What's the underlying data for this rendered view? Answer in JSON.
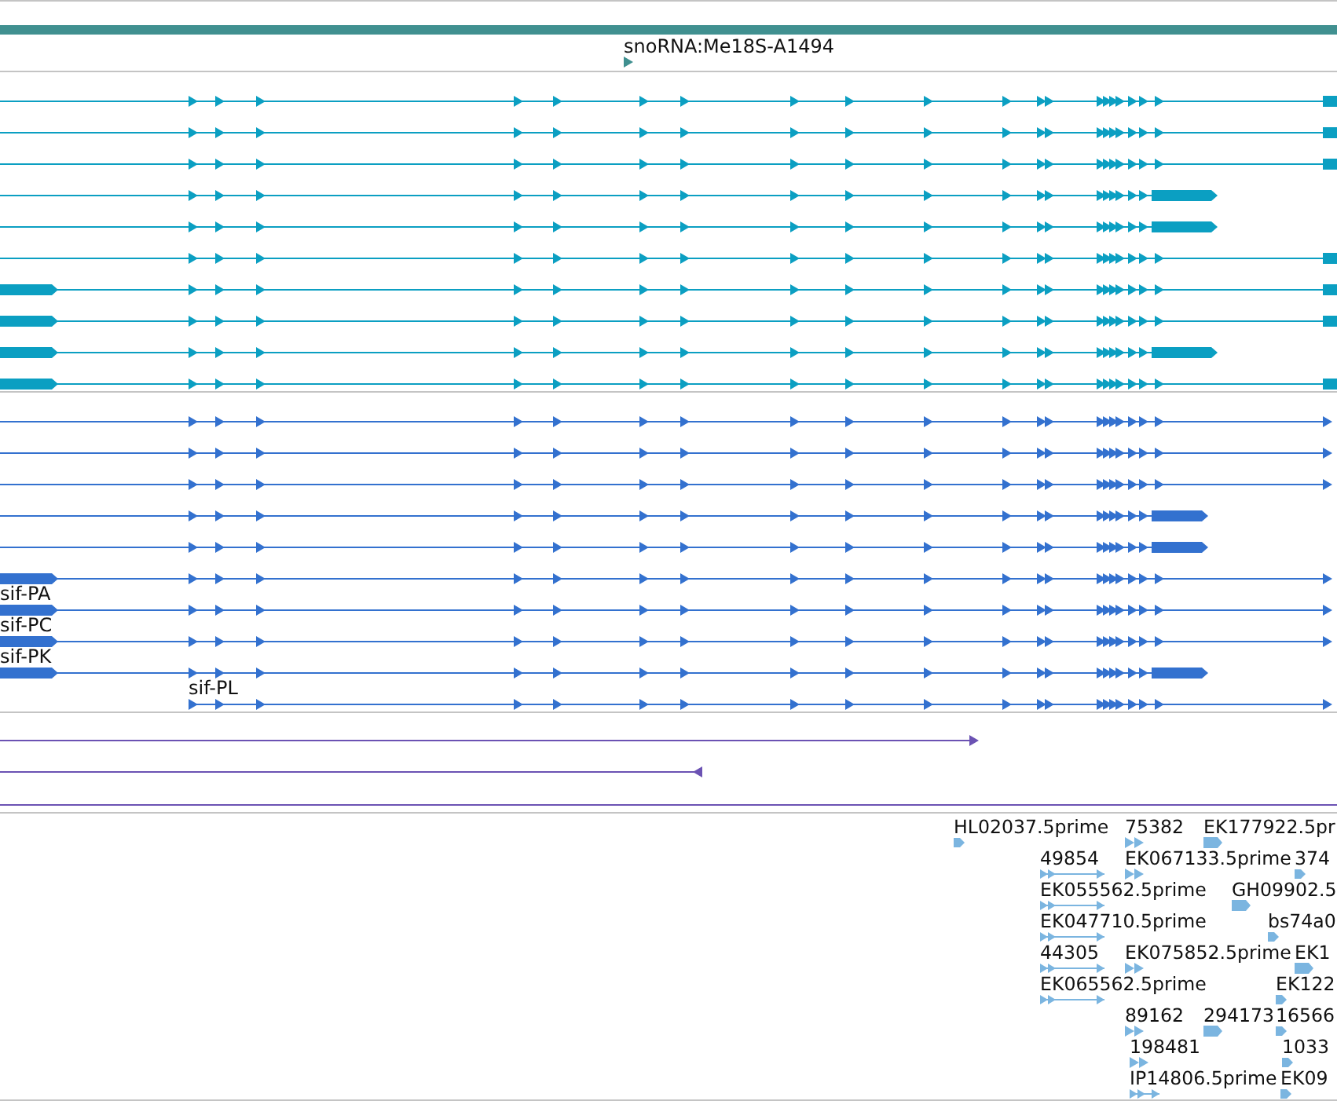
{
  "tracks": [
    {
      "kind": "gene",
      "color": "#409090",
      "features": [
        {
          "kind": "bar"
        },
        {
          "kind": "marker",
          "label": "snoRNA:Me18S-A1494"
        }
      ]
    },
    {
      "kind": "transcripts",
      "color": "#0b9fc2",
      "features": [
        {
          "kind": "edge",
          "utr_start": false,
          "starts_in_view": false
        },
        {
          "kind": "edge",
          "utr_start": false,
          "starts_in_view": false
        },
        {
          "kind": "edge",
          "utr_start": false,
          "starts_in_view": false
        },
        {
          "kind": "tail",
          "utr_start": false,
          "starts_in_view": false
        },
        {
          "kind": "tail",
          "utr_start": false,
          "starts_in_view": false
        },
        {
          "kind": "edge",
          "utr_start": false,
          "starts_in_view": false
        },
        {
          "kind": "edge",
          "utr_start": true,
          "starts_in_view": false
        },
        {
          "kind": "edge",
          "utr_start": true,
          "starts_in_view": false
        },
        {
          "kind": "tail",
          "utr_start": true,
          "starts_in_view": false
        },
        {
          "kind": "edge",
          "utr_start": true,
          "starts_in_view": false
        }
      ]
    },
    {
      "kind": "transcripts",
      "color": "#3371cf",
      "features": [
        {
          "kind": "arrow",
          "utr_start": false,
          "starts_in_view": false
        },
        {
          "kind": "arrow",
          "utr_start": false,
          "starts_in_view": false
        },
        {
          "kind": "arrow",
          "utr_start": false,
          "starts_in_view": false
        },
        {
          "kind": "tail",
          "utr_start": false,
          "starts_in_view": false
        },
        {
          "kind": "tail",
          "utr_start": false,
          "starts_in_view": false
        },
        {
          "kind": "arrow",
          "utr_start": true,
          "starts_in_view": false
        },
        {
          "kind": "arrow",
          "utr_start": true,
          "starts_in_view": false,
          "label": "sif-PA"
        },
        {
          "kind": "arrow",
          "utr_start": true,
          "starts_in_view": false,
          "label": "sif-PC"
        },
        {
          "kind": "tail",
          "utr_start": true,
          "starts_in_view": false,
          "label": "sif-PK"
        },
        {
          "kind": "arrow",
          "utr_start": false,
          "starts_in_view": true,
          "label": "sif-PL"
        }
      ]
    },
    {
      "kind": "alignments",
      "color": "#6b52b3",
      "features": [
        {
          "kind": "forward"
        },
        {
          "kind": "reverse"
        },
        {
          "kind": "continuous"
        }
      ]
    },
    {
      "kind": "matches",
      "color": "#7bb5e0",
      "rows": [
        [
          {
            "label": "HL02037.5prime",
            "kind": "single"
          },
          {
            "label": "75382",
            "kind": "double"
          },
          {
            "label": "EK177922.5pr",
            "kind": "block"
          }
        ],
        [
          {
            "label": "49854",
            "kind": "spliced"
          },
          {
            "label": "EK067133.5prime",
            "kind": "double"
          },
          {
            "label": "374",
            "kind": "single"
          }
        ],
        [
          {
            "label": "EK055562.5prime",
            "kind": "spliced"
          },
          {
            "label": "GH09902.5",
            "kind": "block"
          }
        ],
        [
          {
            "label": "EK047710.5prime",
            "kind": "spliced"
          },
          {
            "label": "bs74a0",
            "kind": "single"
          }
        ],
        [
          {
            "label": "44305",
            "kind": "spliced"
          },
          {
            "label": "EK075852.5prime",
            "kind": "double"
          },
          {
            "label": "EK1",
            "kind": "block"
          }
        ],
        [
          {
            "label": "EK065562.5prime",
            "kind": "spliced"
          },
          {
            "label": "EK122",
            "kind": "single"
          }
        ],
        [
          {
            "label": "89162",
            "kind": "double"
          },
          {
            "label": "294173",
            "kind": "block"
          },
          {
            "label": "16566",
            "kind": "single"
          }
        ],
        [
          {
            "label": "198481",
            "kind": "double"
          },
          {
            "label": "1033",
            "kind": "single"
          }
        ],
        [
          {
            "label": "IP14806.5prime",
            "kind": "linked"
          },
          {
            "label": "EK09",
            "kind": "single"
          }
        ]
      ]
    }
  ]
}
